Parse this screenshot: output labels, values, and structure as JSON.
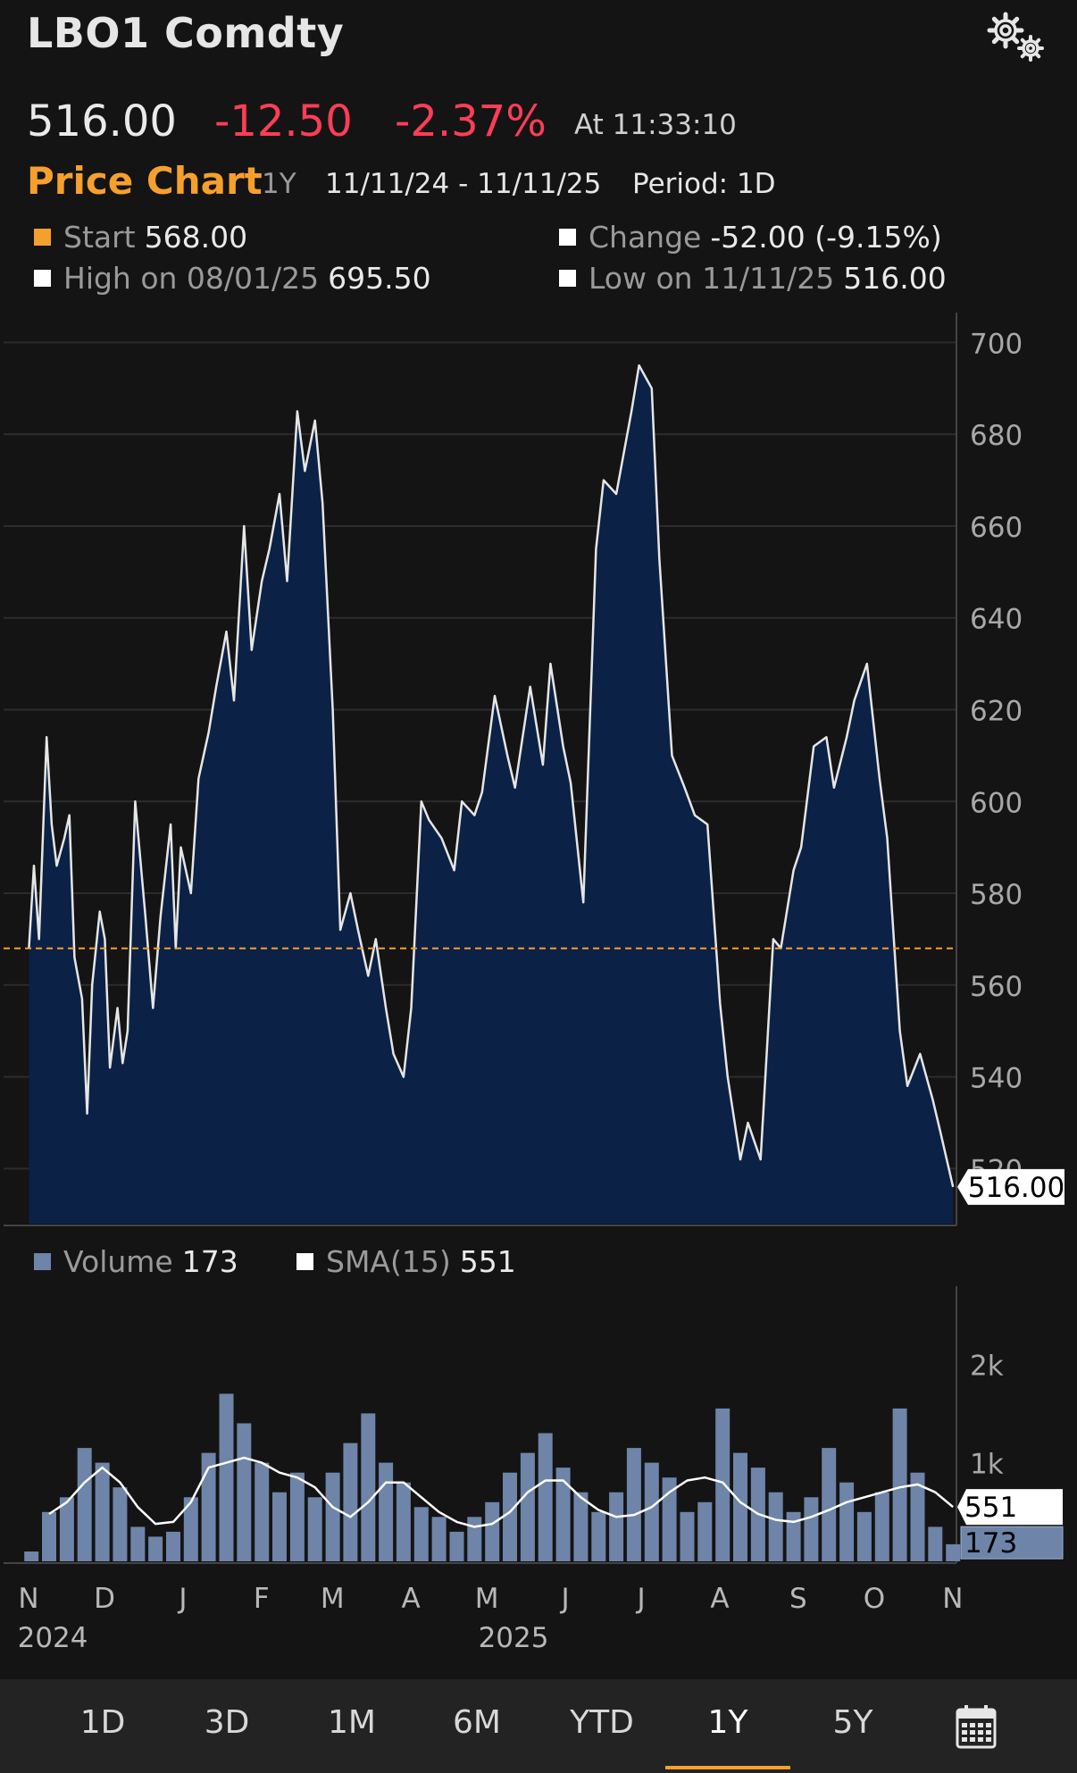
{
  "header": {
    "title": "LBO1 Comdty",
    "last_price": "516.00",
    "net_change": "-12.50",
    "pct_change": "-2.37%",
    "as_of": "At 11:33:10",
    "gear_icon": "settings-gears-icon"
  },
  "subheader": {
    "label": "Price Chart",
    "range": "1Y",
    "dates": "11/11/24 - 11/11/25",
    "period": "Period: 1D"
  },
  "stats": {
    "start_label": "Start",
    "start_value": "568.00",
    "high_label": "High on 08/01/25",
    "high_value": "695.50",
    "change_label": "Change",
    "change_value": "-52.00 (-9.15%)",
    "low_label": "Low on 11/11/25",
    "low_value": "516.00"
  },
  "volume_legend": {
    "volume_label": "Volume",
    "volume_value": "173",
    "sma_label": "SMA(15)",
    "sma_value": "551"
  },
  "colors": {
    "accent": "#f5a02c",
    "negative": "#ff3d57",
    "area_fill": "#0c2146",
    "price_line": "#e6e6e6",
    "volume_bar": "#6e84a8",
    "grid": "#2c2c2c"
  },
  "range_buttons": [
    "1D",
    "3D",
    "1M",
    "6M",
    "YTD",
    "1Y",
    "5Y"
  ],
  "active_range": "1Y",
  "calendar_icon": "calendar-icon",
  "chart_data": [
    {
      "type": "area",
      "series": [
        {
          "name": "Price",
          "x": [
            "2024-11-11",
            "2024-11-13",
            "2024-11-15",
            "2024-11-18",
            "2024-11-20",
            "2024-11-22",
            "2024-11-25",
            "2024-11-27",
            "2024-11-29",
            "2024-12-02",
            "2024-12-04",
            "2024-12-06",
            "2024-12-09",
            "2024-12-11",
            "2024-12-13",
            "2024-12-16",
            "2024-12-18",
            "2024-12-20",
            "2024-12-23",
            "2024-12-27",
            "2024-12-30",
            "2025-01-02",
            "2025-01-06",
            "2025-01-08",
            "2025-01-10",
            "2025-01-14",
            "2025-01-17",
            "2025-01-21",
            "2025-01-24",
            "2025-01-28",
            "2025-01-31",
            "2025-02-04",
            "2025-02-07",
            "2025-02-11",
            "2025-02-14",
            "2025-02-18",
            "2025-02-21",
            "2025-02-25",
            "2025-02-28",
            "2025-03-04",
            "2025-03-07",
            "2025-03-11",
            "2025-03-14",
            "2025-03-18",
            "2025-03-21",
            "2025-03-25",
            "2025-03-28",
            "2025-04-01",
            "2025-04-04",
            "2025-04-08",
            "2025-04-11",
            "2025-04-15",
            "2025-04-18",
            "2025-04-23",
            "2025-04-28",
            "2025-05-01",
            "2025-05-06",
            "2025-05-09",
            "2025-05-14",
            "2025-05-19",
            "2025-05-22",
            "2025-05-28",
            "2025-06-02",
            "2025-06-05",
            "2025-06-10",
            "2025-06-13",
            "2025-06-18",
            "2025-06-23",
            "2025-06-26",
            "2025-07-01",
            "2025-07-07",
            "2025-07-10",
            "2025-07-15",
            "2025-07-18",
            "2025-07-23",
            "2025-07-28",
            "2025-08-01",
            "2025-08-06",
            "2025-08-11",
            "2025-08-14",
            "2025-08-19",
            "2025-08-22",
            "2025-08-27",
            "2025-09-01",
            "2025-09-04",
            "2025-09-09",
            "2025-09-12",
            "2025-09-17",
            "2025-09-22",
            "2025-09-25",
            "2025-09-30",
            "2025-10-03",
            "2025-10-08",
            "2025-10-13",
            "2025-10-16",
            "2025-10-21",
            "2025-10-24",
            "2025-10-29",
            "2025-11-03",
            "2025-11-06",
            "2025-11-11"
          ],
          "values": [
            568,
            586,
            570,
            614,
            595,
            586,
            592,
            597,
            566,
            557,
            532,
            560,
            576,
            570,
            542,
            555,
            543,
            550,
            600,
            575,
            555,
            575,
            595,
            568,
            590,
            580,
            605,
            615,
            625,
            637,
            622,
            660,
            633,
            648,
            655,
            667,
            648,
            685,
            672,
            683,
            665,
            620,
            572,
            580,
            572,
            562,
            570,
            555,
            545,
            540,
            555,
            600,
            596,
            592,
            585,
            600,
            597,
            602,
            623,
            610,
            603,
            625,
            608,
            630,
            612,
            604,
            578,
            655,
            670,
            667,
            685,
            695,
            690,
            653,
            610,
            603,
            597,
            595,
            556,
            540,
            522,
            530,
            522,
            570,
            568,
            585,
            590,
            612,
            614,
            603,
            614,
            622,
            630,
            605,
            592,
            550,
            538,
            545,
            535,
            528,
            516
          ]
        }
      ],
      "ylim": [
        508,
        703
      ],
      "y_ticks": [
        520,
        540,
        560,
        580,
        600,
        620,
        640,
        660,
        680,
        700
      ],
      "reference_line": 568.0,
      "last_value_label": "516.00",
      "grid": true
    },
    {
      "type": "bar",
      "series": [
        {
          "name": "Volume",
          "x": [
            "2024-11-12",
            "2024-11-19",
            "2024-11-26",
            "2024-12-03",
            "2024-12-10",
            "2024-12-17",
            "2024-12-24",
            "2024-12-31",
            "2025-01-07",
            "2025-01-14",
            "2025-01-21",
            "2025-01-28",
            "2025-02-04",
            "2025-02-11",
            "2025-02-18",
            "2025-02-25",
            "2025-03-04",
            "2025-03-11",
            "2025-03-18",
            "2025-03-25",
            "2025-04-01",
            "2025-04-08",
            "2025-04-15",
            "2025-04-22",
            "2025-04-29",
            "2025-05-06",
            "2025-05-13",
            "2025-05-20",
            "2025-05-27",
            "2025-06-03",
            "2025-06-10",
            "2025-06-17",
            "2025-06-24",
            "2025-07-01",
            "2025-07-08",
            "2025-07-15",
            "2025-07-22",
            "2025-07-29",
            "2025-08-05",
            "2025-08-12",
            "2025-08-19",
            "2025-08-26",
            "2025-09-02",
            "2025-09-09",
            "2025-09-16",
            "2025-09-23",
            "2025-09-30",
            "2025-10-07",
            "2025-10-14",
            "2025-10-21",
            "2025-10-28",
            "2025-11-04",
            "2025-11-11"
          ],
          "values": [
            100,
            500,
            650,
            1150,
            1000,
            750,
            350,
            250,
            300,
            650,
            1100,
            1700,
            1400,
            1000,
            700,
            900,
            650,
            900,
            1200,
            1500,
            1000,
            800,
            550,
            450,
            300,
            450,
            600,
            900,
            1100,
            1300,
            950,
            700,
            500,
            700,
            1150,
            1000,
            850,
            500,
            600,
            1550,
            1100,
            950,
            700,
            500,
            650,
            1150,
            800,
            500,
            700,
            1550,
            900,
            350,
            173
          ]
        },
        {
          "name": "SMA(15)",
          "x": [
            "2024-11-19",
            "2024-11-26",
            "2024-12-03",
            "2024-12-10",
            "2024-12-17",
            "2024-12-24",
            "2024-12-31",
            "2025-01-07",
            "2025-01-14",
            "2025-01-21",
            "2025-01-28",
            "2025-02-04",
            "2025-02-11",
            "2025-02-18",
            "2025-02-25",
            "2025-03-04",
            "2025-03-11",
            "2025-03-18",
            "2025-03-25",
            "2025-04-01",
            "2025-04-08",
            "2025-04-15",
            "2025-04-22",
            "2025-04-29",
            "2025-05-06",
            "2025-05-13",
            "2025-05-20",
            "2025-05-27",
            "2025-06-03",
            "2025-06-10",
            "2025-06-17",
            "2025-06-24",
            "2025-07-01",
            "2025-07-08",
            "2025-07-15",
            "2025-07-22",
            "2025-07-29",
            "2025-08-05",
            "2025-08-12",
            "2025-08-19",
            "2025-08-26",
            "2025-09-02",
            "2025-09-09",
            "2025-09-16",
            "2025-09-23",
            "2025-09-30",
            "2025-10-07",
            "2025-10-14",
            "2025-10-21",
            "2025-10-28",
            "2025-11-04",
            "2025-11-11"
          ],
          "values": [
            480,
            600,
            800,
            950,
            800,
            550,
            380,
            400,
            600,
            950,
            1000,
            1050,
            1000,
            900,
            850,
            750,
            550,
            450,
            600,
            800,
            800,
            650,
            500,
            400,
            350,
            380,
            500,
            700,
            820,
            820,
            650,
            520,
            450,
            470,
            550,
            700,
            820,
            850,
            800,
            600,
            480,
            420,
            400,
            450,
            520,
            600,
            650,
            700,
            750,
            780,
            700,
            551
          ]
        }
      ],
      "ylim": [
        0,
        2700
      ],
      "y_ticks": [
        1000,
        2000
      ],
      "y_tick_labels": [
        "1k",
        "2k"
      ],
      "sma_value_label": "551",
      "volume_value_label": "173"
    }
  ],
  "x_axis": {
    "months": [
      {
        "label": "N",
        "date": "2024-11-01"
      },
      {
        "label": "D",
        "date": "2024-12-01"
      },
      {
        "label": "J",
        "date": "2025-01-01"
      },
      {
        "label": "F",
        "date": "2025-02-01"
      },
      {
        "label": "M",
        "date": "2025-03-01"
      },
      {
        "label": "A",
        "date": "2025-04-01"
      },
      {
        "label": "M",
        "date": "2025-05-01"
      },
      {
        "label": "J",
        "date": "2025-06-01"
      },
      {
        "label": "J",
        "date": "2025-07-01"
      },
      {
        "label": "A",
        "date": "2025-08-01"
      },
      {
        "label": "S",
        "date": "2025-09-01"
      },
      {
        "label": "O",
        "date": "2025-10-01"
      },
      {
        "label": "N",
        "date": "2025-11-01"
      }
    ],
    "years": [
      {
        "label": "2024",
        "date": "2024-12-01"
      },
      {
        "label": "2025",
        "date": "2025-06-01"
      }
    ]
  }
}
